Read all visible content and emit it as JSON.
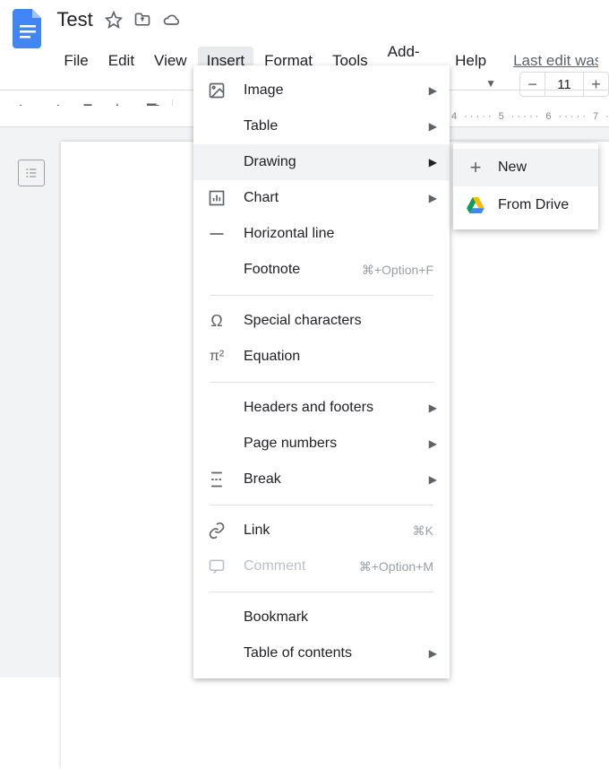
{
  "doc": {
    "title": "Test",
    "last_edit": "Last edit was s"
  },
  "menubar": {
    "file": "File",
    "edit": "Edit",
    "view": "View",
    "insert": "Insert",
    "format": "Format",
    "tools": "Tools",
    "addons": "Add-ons",
    "help": "Help"
  },
  "toolbar": {
    "font_size": "11"
  },
  "ruler": {
    "n4": "4",
    "n5": "5",
    "n6": "6",
    "n7": "7"
  },
  "insert_menu": {
    "image": "Image",
    "table": "Table",
    "drawing": "Drawing",
    "chart": "Chart",
    "hline": "Horizontal line",
    "footnote": "Footnote",
    "footnote_sc": "⌘+Option+F",
    "special": "Special characters",
    "equation": "Equation",
    "headers": "Headers and footers",
    "pagenums": "Page numbers",
    "break": "Break",
    "link": "Link",
    "link_sc": "⌘K",
    "comment": "Comment",
    "comment_sc": "⌘+Option+M",
    "bookmark": "Bookmark",
    "toc": "Table of contents"
  },
  "drawing_submenu": {
    "new": "New",
    "drive": "From Drive"
  }
}
